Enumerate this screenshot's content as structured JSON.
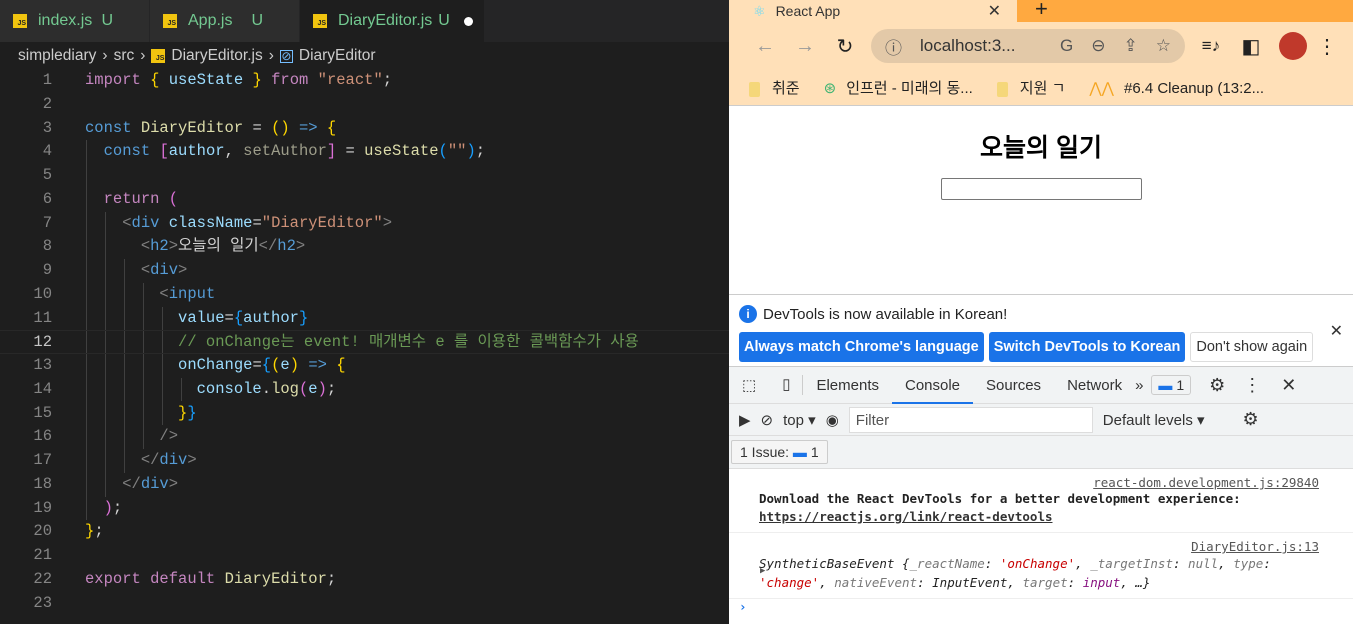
{
  "editor": {
    "tabs": [
      {
        "label": "index.js",
        "status": "U"
      },
      {
        "label": "App.js",
        "status": "U"
      },
      {
        "label": "DiaryEditor.js",
        "status": "U",
        "active": true,
        "unsaved": true
      }
    ],
    "breadcrumb": [
      "simplediary",
      "src",
      "DiaryEditor.js",
      "DiaryEditor"
    ],
    "current_line": 12,
    "lines": [
      [
        [
          "import",
          "kw"
        ],
        [
          " ",
          "w"
        ],
        [
          "{",
          "y"
        ],
        [
          " ",
          "w"
        ],
        [
          "useState",
          "v"
        ],
        [
          " ",
          "w"
        ],
        [
          "}",
          "y"
        ],
        [
          " ",
          "w"
        ],
        [
          "from",
          "kw"
        ],
        [
          " ",
          "w"
        ],
        [
          "\"react\"",
          "s"
        ],
        [
          ";",
          "w"
        ]
      ],
      [],
      [
        [
          "const",
          "bl"
        ],
        [
          " ",
          "w"
        ],
        [
          "DiaryEditor",
          "f"
        ],
        [
          " = ",
          "w"
        ],
        [
          "()",
          "y"
        ],
        [
          " ",
          "w"
        ],
        [
          "=>",
          "bl"
        ],
        [
          " ",
          "w"
        ],
        [
          "{",
          "y"
        ]
      ],
      [
        [
          "  ",
          "w"
        ],
        [
          "const",
          "bl"
        ],
        [
          " ",
          "w"
        ],
        [
          "[",
          "p"
        ],
        [
          "author",
          "v"
        ],
        [
          ", ",
          "w"
        ],
        [
          "setAuthor",
          "dim"
        ],
        [
          "]",
          "p"
        ],
        [
          " = ",
          "w"
        ],
        [
          "useState",
          "f"
        ],
        [
          "(",
          "b"
        ],
        [
          "\"\"",
          "s"
        ],
        [
          ")",
          "b"
        ],
        [
          ";",
          "w"
        ]
      ],
      [],
      [
        [
          "  ",
          "w"
        ],
        [
          "return",
          "kw"
        ],
        [
          " ",
          "w"
        ],
        [
          "(",
          "p"
        ]
      ],
      [
        [
          "    ",
          "w"
        ],
        [
          "<",
          "g"
        ],
        [
          "div",
          "bl"
        ],
        [
          " ",
          "w"
        ],
        [
          "className",
          "v"
        ],
        [
          "=",
          "w"
        ],
        [
          "\"DiaryEditor\"",
          "s"
        ],
        [
          ">",
          "g"
        ]
      ],
      [
        [
          "      ",
          "w"
        ],
        [
          "<",
          "g"
        ],
        [
          "h2",
          "bl"
        ],
        [
          ">",
          "g"
        ],
        [
          "오늘의 일기",
          "w"
        ],
        [
          "</",
          "g"
        ],
        [
          "h2",
          "bl"
        ],
        [
          ">",
          "g"
        ]
      ],
      [
        [
          "      ",
          "w"
        ],
        [
          "<",
          "g"
        ],
        [
          "div",
          "bl"
        ],
        [
          ">",
          "g"
        ]
      ],
      [
        [
          "        ",
          "w"
        ],
        [
          "<",
          "g"
        ],
        [
          "input",
          "bl"
        ]
      ],
      [
        [
          "          ",
          "w"
        ],
        [
          "value",
          "v"
        ],
        [
          "=",
          "w"
        ],
        [
          "{",
          "b"
        ],
        [
          "author",
          "v"
        ],
        [
          "}",
          "b"
        ]
      ],
      [
        [
          "          ",
          "w"
        ],
        [
          "// onChange는 event! 매개변수 e 를 이용한 콜백함수가 사용",
          "cm"
        ]
      ],
      [
        [
          "          ",
          "w"
        ],
        [
          "onChange",
          "v"
        ],
        [
          "=",
          "w"
        ],
        [
          "{",
          "b"
        ],
        [
          "(",
          "y"
        ],
        [
          "e",
          "v"
        ],
        [
          ")",
          "y"
        ],
        [
          " ",
          "w"
        ],
        [
          "=>",
          "bl"
        ],
        [
          " ",
          "w"
        ],
        [
          "{",
          "y"
        ]
      ],
      [
        [
          "            ",
          "w"
        ],
        [
          "console",
          "v"
        ],
        [
          ".",
          "w"
        ],
        [
          "log",
          "f"
        ],
        [
          "(",
          "p"
        ],
        [
          "e",
          "v"
        ],
        [
          ")",
          "p"
        ],
        [
          ";",
          "w"
        ]
      ],
      [
        [
          "          ",
          "w"
        ],
        [
          "}",
          "y"
        ],
        [
          "}",
          "b"
        ]
      ],
      [
        [
          "        ",
          "w"
        ],
        [
          "/>",
          "g"
        ]
      ],
      [
        [
          "      ",
          "w"
        ],
        [
          "</",
          "g"
        ],
        [
          "div",
          "bl"
        ],
        [
          ">",
          "g"
        ]
      ],
      [
        [
          "    ",
          "w"
        ],
        [
          "</",
          "g"
        ],
        [
          "div",
          "bl"
        ],
        [
          ">",
          "g"
        ]
      ],
      [
        [
          "  ",
          "w"
        ],
        [
          ")",
          "p"
        ],
        [
          ";",
          "w"
        ]
      ],
      [
        [
          "}",
          "y"
        ],
        [
          ";",
          "w"
        ]
      ],
      [],
      [
        [
          "export",
          "kw"
        ],
        [
          " ",
          "w"
        ],
        [
          "default",
          "kw"
        ],
        [
          " ",
          "w"
        ],
        [
          "DiaryEditor",
          "f"
        ],
        [
          ";",
          "w"
        ]
      ],
      []
    ]
  },
  "browser": {
    "tab_title": "React App",
    "address": "localhost:3...",
    "bookmarks": [
      "취준",
      "인프런 - 미래의 동...",
      "지원 ㄱ",
      "#6.4 Cleanup (13:2..."
    ],
    "page": {
      "heading": "오늘의 일기",
      "input_value": ""
    },
    "accent": "#ffa940"
  },
  "devtools": {
    "info": "DevTools is now available in Korean!",
    "buttons": [
      "Always match Chrome's language",
      "Switch DevTools to Korean",
      "Don't show again"
    ],
    "tabs": [
      "Elements",
      "Console",
      "Sources",
      "Network"
    ],
    "active_tab": "Console",
    "more": "»",
    "issues_badge": "1",
    "context": "top",
    "filter_placeholder": "Filter",
    "levels": "Default levels",
    "issues_label": "1 Issue:",
    "issues_count": "1",
    "messages": [
      {
        "source": "react-dom.development.js:29840",
        "text": "Download the React DevTools for a better development experience: ",
        "link": "https://reactjs.org/link/react-devtools"
      },
      {
        "source": "DiaryEditor.js:13",
        "obj": "SyntheticBaseEvent",
        "k1": "_reactName",
        "v1": "'onChange'",
        "k2": "_targetInst",
        "v2": "null",
        "k3": "type",
        "v3": "'change'",
        "k4": "nativeEvent",
        "v4": "InputEvent",
        "k5": "target",
        "v5": "input",
        "rest": "…}"
      }
    ]
  }
}
